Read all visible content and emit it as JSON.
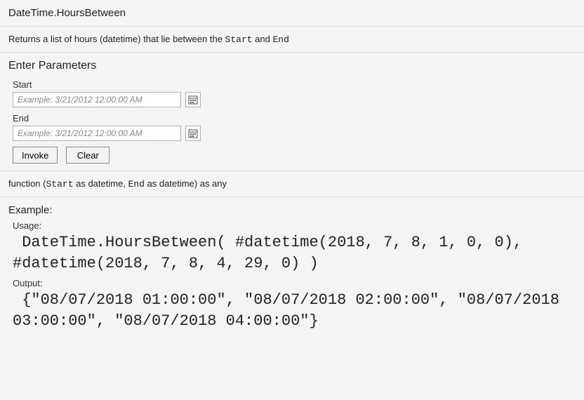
{
  "header": {
    "title": "DateTime.HoursBetween"
  },
  "description": {
    "prefix": "Returns a list of hours (datetime) that lie between the ",
    "p1": "Start",
    "mid": " and ",
    "p2": "End"
  },
  "parameters": {
    "heading": "Enter Parameters",
    "fields": [
      {
        "label": "Start",
        "placeholder": "Example: 3/21/2012 12:00:00 AM"
      },
      {
        "label": "End",
        "placeholder": "Example: 3/21/2012 12:00:00 AM"
      }
    ],
    "buttons": {
      "invoke": "Invoke",
      "clear": "Clear"
    }
  },
  "signature": {
    "t1": "function (",
    "p1": "Start",
    "t2": " as datetime, ",
    "p2": "End",
    "t3": " as datetime) as any"
  },
  "example": {
    "heading": "Example:",
    "usage_label": "Usage:",
    "usage_code": " DateTime.HoursBetween( #datetime(2018, 7, 8, 1, 0, 0), #datetime(2018, 7, 8, 4, 29, 0) )",
    "output_label": "Output:",
    "output_code": " {\"08/07/2018 01:00:00\", \"08/07/2018 02:00:00\", \"08/07/2018 03:00:00\", \"08/07/2018 04:00:00\"}"
  }
}
